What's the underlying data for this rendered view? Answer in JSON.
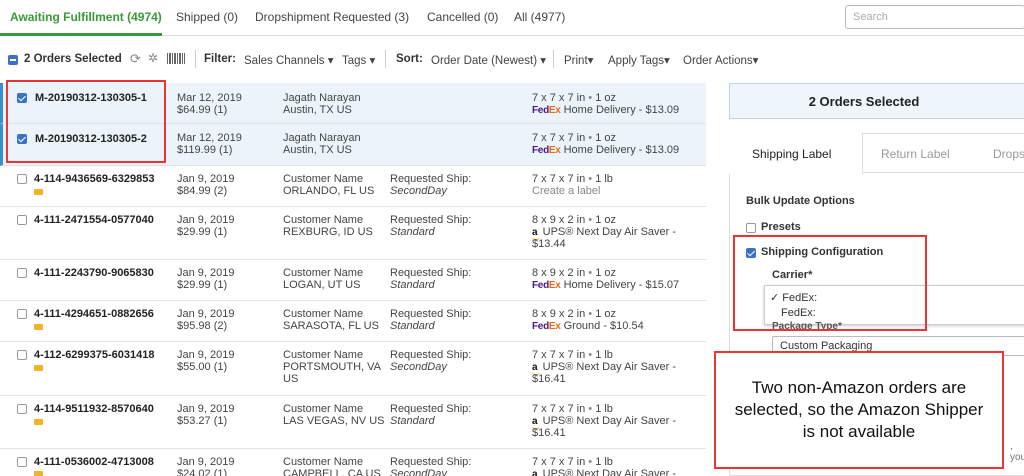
{
  "tabs": [
    {
      "label": "Awaiting Fulfillment (4974)",
      "active": true
    },
    {
      "label": "Shipped (0)"
    },
    {
      "label": "Dropshipment Requested (3)"
    },
    {
      "label": "Cancelled (0)"
    },
    {
      "label": "All (4977)"
    }
  ],
  "search": {
    "placeholder": "Search"
  },
  "toolbar": {
    "selected_label": "2 Orders Selected",
    "filter_label": "Filter:",
    "sales_channels": "Sales Channels",
    "tags": "Tags",
    "sort_label": "Sort:",
    "sort_value": "Order Date (Newest)",
    "print": "Print",
    "apply_tags": "Apply Tags",
    "order_actions": "Order Actions"
  },
  "orders": [
    {
      "id": "M-20190312-130305-1",
      "date": "Mar 12, 2019",
      "price": "$64.99 (1)",
      "customer": "Jagath Narayan",
      "location": "Austin, TX US",
      "req_label": "",
      "req_value": "",
      "dims": "7 x 7 x 7 in",
      "weight": "1 oz",
      "carrier": "fedex",
      "service": "Home Delivery - $13.09",
      "service2": "",
      "selected": true
    },
    {
      "id": "M-20190312-130305-2",
      "date": "Mar 12, 2019",
      "price": "$119.99 (1)",
      "customer": "Jagath Narayan",
      "location": "Austin, TX US",
      "req_label": "",
      "req_value": "",
      "dims": "7 x 7 x 7 in",
      "weight": "1 oz",
      "carrier": "fedex",
      "service": "Home Delivery - $13.09",
      "service2": "",
      "selected": true
    },
    {
      "id": "4-114-9436569-6329853",
      "date": "Jan 9, 2019",
      "price": "$84.99 (2)",
      "customer": "Customer Name",
      "location": "ORLANDO, FL US",
      "location2": "",
      "req_label": "Requested Ship:",
      "req_value": "SecondDay",
      "dims": "7 x 7 x 7 in",
      "weight": "1 lb",
      "carrier": "none",
      "service": "Create a label",
      "service2": "",
      "selected": false
    },
    {
      "id": "4-111-2471554-0577040",
      "date": "Jan 9, 2019",
      "price": "$29.99 (1)",
      "customer": "Customer Name",
      "location": "REXBURG, ID US",
      "location2": "",
      "req_label": "Requested Ship:",
      "req_value": "Standard",
      "dims": "8 x 9 x 2 in",
      "weight": "1 oz",
      "carrier": "amazon",
      "service": "UPS® Next Day Air Saver -",
      "service2": "$13.44",
      "selected": false
    },
    {
      "id": "4-111-2243790-9065830",
      "date": "Jan 9, 2019",
      "price": "$29.99 (1)",
      "customer": "Customer Name",
      "location": "LOGAN, UT US",
      "location2": "",
      "req_label": "Requested Ship:",
      "req_value": "Standard",
      "dims": "8 x 9 x 2 in",
      "weight": "1 oz",
      "carrier": "fedex",
      "service": "Home Delivery - $15.07",
      "service2": "",
      "selected": false
    },
    {
      "id": "4-111-4294651-0882656",
      "date": "Jan 9, 2019",
      "price": "$95.98 (2)",
      "customer": "Customer Name",
      "location": "SARASOTA, FL US",
      "location2": "",
      "req_label": "Requested Ship:",
      "req_value": "Standard",
      "dims": "8 x 9 x 2 in",
      "weight": "1 oz",
      "carrier": "fedex",
      "service": "Ground - $10.54",
      "service2": "",
      "selected": false
    },
    {
      "id": "4-112-6299375-6031418",
      "date": "Jan 9, 2019",
      "price": "$55.00 (1)",
      "customer": "Customer Name",
      "location": "PORTSMOUTH, VA",
      "location2": "US",
      "req_label": "Requested Ship:",
      "req_value": "SecondDay",
      "dims": "7 x 7 x 7 in",
      "weight": "1 lb",
      "carrier": "amazon",
      "service": "UPS® Next Day Air Saver -",
      "service2": "$16.41",
      "selected": false
    },
    {
      "id": "4-114-9511932-8570640",
      "date": "Jan 9, 2019",
      "price": "$53.27 (1)",
      "customer": "Customer Name",
      "location": "LAS VEGAS, NV US",
      "location2": "",
      "req_label": "Requested Ship:",
      "req_value": "Standard",
      "dims": "7 x 7 x 7 in",
      "weight": "1 lb",
      "carrier": "amazon",
      "service": "UPS® Next Day Air Saver -",
      "service2": "$16.41",
      "selected": false
    },
    {
      "id": "4-111-0536002-4713008",
      "date": "Jan 9, 2019",
      "price": "$24.02 (1)",
      "customer": "Customer Name",
      "location": "CAMPBELL, CA US",
      "location2": "",
      "req_label": "Requested Ship:",
      "req_value": "SecondDay",
      "dims": "7 x 7 x 7 in",
      "weight": "1 lb",
      "carrier": "amazon",
      "service": "UPS® Next Day Air Saver -",
      "service2": "",
      "selected": false
    }
  ],
  "carrier_logos": {
    "fedex_fe": "Fed",
    "fedex_ex": "Ex",
    "amazon": "a"
  },
  "right_panel": {
    "header": "2 Orders Selected",
    "tabs": [
      "Shipping Label",
      "Return Label",
      "Drops"
    ],
    "bulk_update": "Bulk Update Options",
    "presets": "Presets",
    "shipping_config": "Shipping Configuration",
    "carrier_label": "Carrier*",
    "carrier_options": [
      "✓ FedEx:",
      "FedEx:"
    ],
    "package_type_label": "Package Type*",
    "package_type_value": "Custom Packaging",
    "cut_text": ", you"
  },
  "annotation": {
    "callout": "Two non-Amazon orders are selected, so the Amazon Shipper is not available",
    "color": "#e33333"
  }
}
